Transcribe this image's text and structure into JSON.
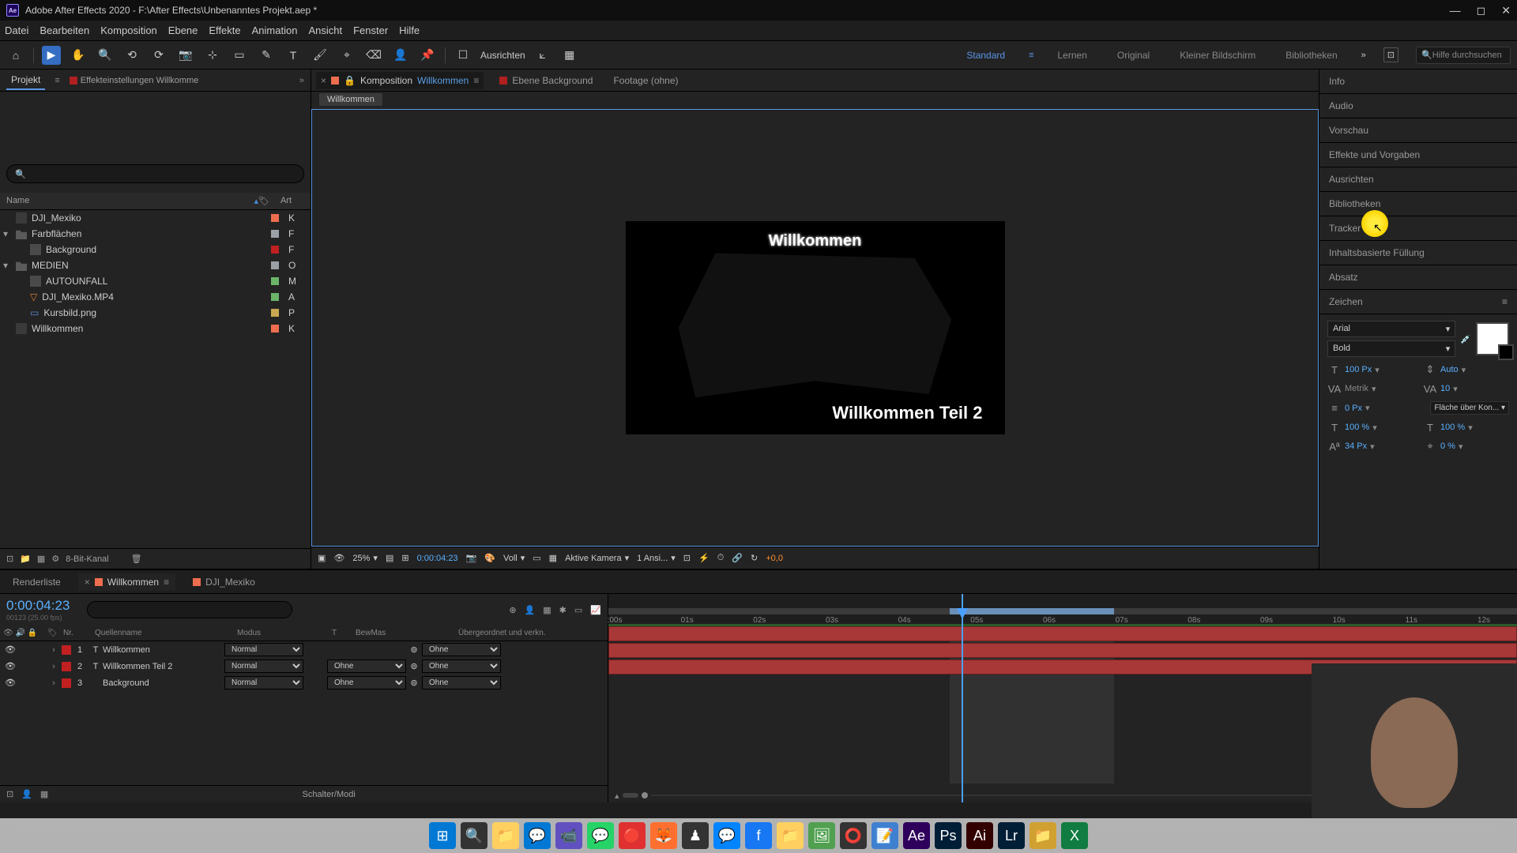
{
  "titlebar": {
    "app": "Adobe After Effects 2020",
    "path": "F:\\After Effects\\Unbenanntes Projekt.aep *"
  },
  "menu": [
    "Datei",
    "Bearbeiten",
    "Komposition",
    "Ebene",
    "Effekte",
    "Animation",
    "Ansicht",
    "Fenster",
    "Hilfe"
  ],
  "toolbar": {
    "ausrichten": "Ausrichten",
    "workspaces": [
      "Standard",
      "Lernen",
      "Original",
      "Kleiner Bildschirm",
      "Bibliotheken"
    ],
    "help_search": "Hilfe durchsuchen"
  },
  "project": {
    "tab_project": "Projekt",
    "tab_effect": "Effekteinstellungen Willkomme",
    "header_name": "Name",
    "header_art": "Art",
    "items": [
      {
        "name": "DJI_Mexiko",
        "type": "comp",
        "color": "#ed6d4e",
        "art": "K",
        "indent": 0,
        "twirl": ""
      },
      {
        "name": "Farbflächen",
        "type": "folder",
        "color": "#9aa0a6",
        "art": "F",
        "indent": 0,
        "twirl": "▾"
      },
      {
        "name": "Background",
        "type": "solid",
        "color": "#c02020",
        "art": "F",
        "indent": 1,
        "twirl": ""
      },
      {
        "name": "MEDIEN",
        "type": "folder",
        "color": "#9aa0a6",
        "art": "O",
        "indent": 0,
        "twirl": "▾"
      },
      {
        "name": "AUTOUNFALL",
        "type": "file",
        "color": "#6ab568",
        "art": "M",
        "indent": 1,
        "twirl": ""
      },
      {
        "name": "DJI_Mexiko.MP4",
        "type": "video",
        "color": "#6ab568",
        "art": "A",
        "indent": 1,
        "twirl": ""
      },
      {
        "name": "Kursbild.png",
        "type": "image",
        "color": "#c8a850",
        "art": "P",
        "indent": 1,
        "twirl": ""
      },
      {
        "name": "Willkommen",
        "type": "comp",
        "color": "#ed6d4e",
        "art": "K",
        "indent": 0,
        "twirl": ""
      }
    ],
    "footer_bpc": "8-Bit-Kanal"
  },
  "composition": {
    "tab_comp_label": "Komposition",
    "tab_comp_name": "Willkommen",
    "tab_layer": "Ebene Background",
    "tab_footage": "Footage (ohne)",
    "breadcrumb": "Willkommen",
    "canvas_text1": "Willkommen",
    "canvas_text2": "Willkommen Teil 2",
    "zoom": "25%",
    "timecode": "0:00:04:23",
    "resolution": "Voll",
    "camera": "Aktive Kamera",
    "views": "1 Ansi...",
    "offset": "+0,0"
  },
  "right_panels": {
    "info": "Info",
    "audio": "Audio",
    "vorschau": "Vorschau",
    "effekte": "Effekte und Vorgaben",
    "ausrichten": "Ausrichten",
    "bibliotheken": "Bibliotheken",
    "tracker": "Tracker",
    "inhalt": "Inhaltsbasierte Füllung",
    "absatz": "Absatz",
    "zeichen": "Zeichen"
  },
  "character": {
    "font": "Arial",
    "style": "Bold",
    "size": "100 Px",
    "leading_auto": "Auto",
    "kerning": "Metrik",
    "tracking": "10",
    "stroke": "0 Px",
    "stroke_type": "Fläche über Kon...",
    "hscale": "100 %",
    "vscale": "100 %",
    "baseline": "34 Px",
    "tsume": "0 %"
  },
  "timeline": {
    "tab_render": "Renderliste",
    "tab_comp1": "Willkommen",
    "tab_comp2": "DJI_Mexiko",
    "timecode": "0:00:04:23",
    "timecode_sub": "00123 (25.00 fps)",
    "header": {
      "nr": "Nr.",
      "name": "Quellenname",
      "mode": "Modus",
      "t": "T",
      "bew": "BewMas",
      "parent": "Übergeordnet und verkn."
    },
    "layers": [
      {
        "num": "1",
        "name": "Willkommen",
        "mode": "Normal",
        "trk": "",
        "parent": "Ohne",
        "color": "#c02020",
        "type": "T"
      },
      {
        "num": "2",
        "name": "Willkommen Teil 2",
        "mode": "Normal",
        "trk": "Ohne",
        "parent": "Ohne",
        "color": "#c02020",
        "type": "T"
      },
      {
        "num": "3",
        "name": "Background",
        "mode": "Normal",
        "trk": "Ohne",
        "parent": "Ohne",
        "color": "#c02020",
        "type": ""
      }
    ],
    "ticks": [
      ":00s",
      "01s",
      "02s",
      "03s",
      "04s",
      "05s",
      "06s",
      "07s",
      "08s",
      "09s",
      "10s",
      "11s",
      "12s"
    ],
    "footer": "Schalter/Modi"
  },
  "taskbar_icons": [
    "⊞",
    "🔍",
    "📁",
    "💬",
    "📹",
    "💬",
    "🔴",
    "🦊",
    "♟",
    "💬",
    "f",
    "📁",
    "🖼",
    "⭕",
    "📝",
    "Ae",
    "Ps",
    "Ai",
    "Lr",
    "📁",
    "X"
  ]
}
